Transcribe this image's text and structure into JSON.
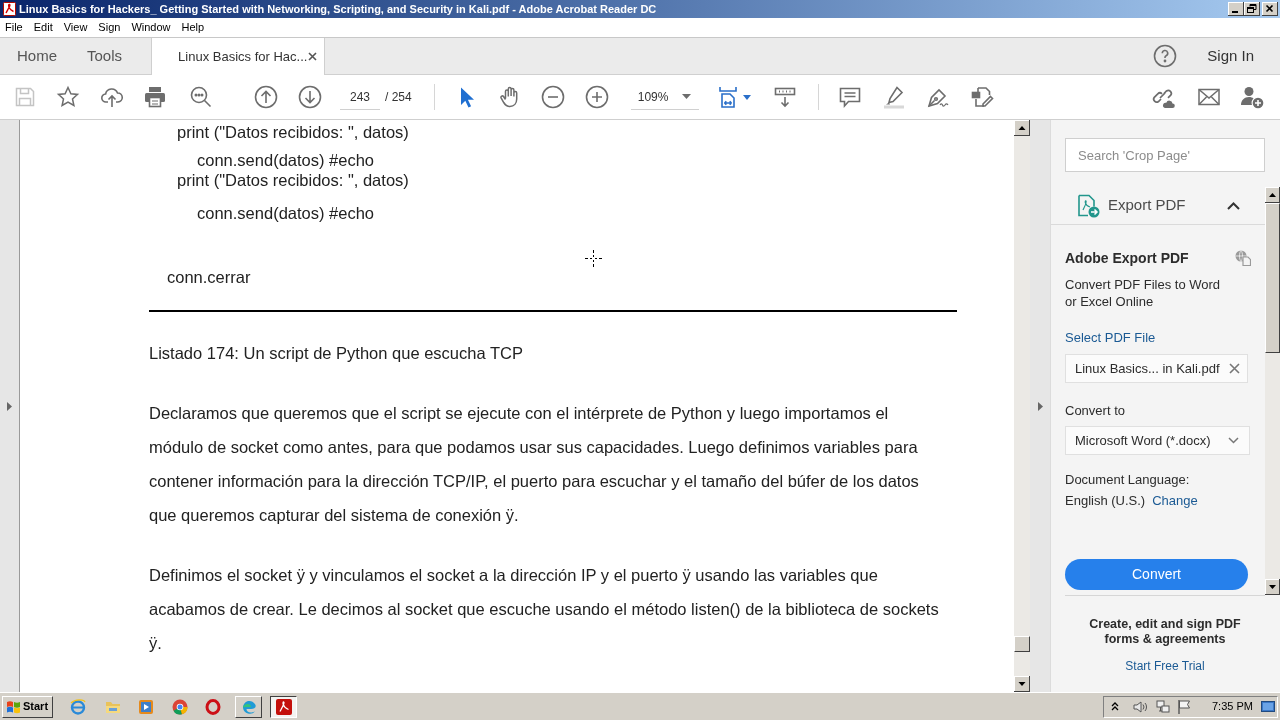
{
  "window": {
    "title": "Linux Basics for Hackers_ Getting Started with Networking, Scripting, and Security in Kali.pdf - Adobe Acrobat Reader DC"
  },
  "menu": [
    "File",
    "Edit",
    "View",
    "Sign",
    "Window",
    "Help"
  ],
  "tabs": [
    {
      "kind": "nav",
      "label": "Home",
      "selected": false
    },
    {
      "kind": "nav",
      "label": "Tools",
      "selected": false
    },
    {
      "kind": "document",
      "label": "Linux Basics for Hac...",
      "selected": true
    }
  ],
  "account": {
    "label": "Sign In"
  },
  "toolbar": {
    "save": {
      "disabled": true
    },
    "page": {
      "value": "243",
      "total": "/ 254"
    },
    "tools": [
      {
        "kind": "select",
        "selected": true
      },
      {
        "kind": "hand",
        "selected": false
      }
    ],
    "zoom": {
      "value": "109%"
    }
  },
  "document": {
    "code_lines": [
      "print (\"Datos recibidos: \", datos)",
      "conn.send(datos) #echo",
      "print (\"Datos recibidos: \", datos)",
      "conn.send(datos) #echo",
      "conn.cerrar"
    ],
    "caption": "Listado 174: Un script de Python que escucha TCP",
    "paragraphs": [
      "Declaramos que queremos que el script se ejecute con el intérprete de Python y luego importamos el módulo de socket como antes, para que podamos usar sus capacidades. Luego definimos variables para contener información para la dirección TCP/IP, el puerto para escuchar y el tamaño del búfer de los datos que queremos capturar del sistema de conexión ÿ.",
      "Definimos el socket ÿ y vinculamos el socket a la dirección IP y el puerto ÿ usando las variables que acabamos de crear. Le decimos al socket que escuche usando el método listen() de la biblioteca de sockets ÿ."
    ]
  },
  "tools_pane": {
    "search": {
      "placeholder": "Search 'Crop Page'"
    },
    "tool": {
      "label": "Export PDF",
      "expanded": true
    },
    "heading": "Adobe Export PDF",
    "description": "Convert PDF Files to Word or Excel Online",
    "select_link": "Select PDF File",
    "file": {
      "value": "Linux Basics... in Kali.pdf"
    },
    "convert_to_label": "Convert to",
    "format": {
      "value": "Microsoft Word (*.docx)"
    },
    "language_label": "Document Language:",
    "language": "English (U.S.)",
    "change_link": "Change",
    "convert_button": "Convert",
    "promo": {
      "text": "Create, edit and sign PDF forms & agreements",
      "link": "Start Free Trial"
    }
  },
  "taskbar": {
    "start": "Start",
    "windows": [
      {
        "kind": "swirl",
        "active": false
      },
      {
        "kind": "pdf",
        "active": true
      }
    ],
    "clock": "7:35 PM"
  }
}
